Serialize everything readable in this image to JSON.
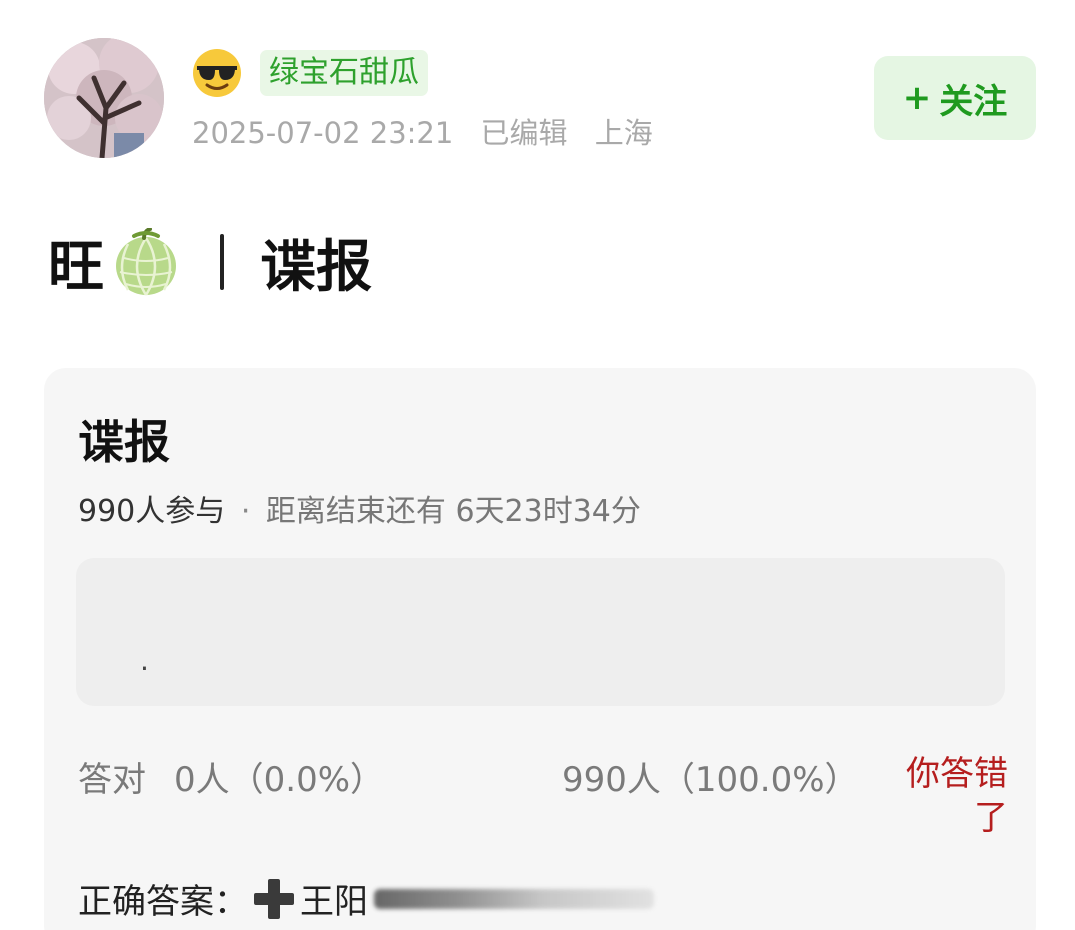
{
  "author": {
    "badge": "绿宝石甜瓜",
    "datetime": "2025-07-02 23:21",
    "edited": "已编辑",
    "location": "上海"
  },
  "follow_button": {
    "plus": "+",
    "label": "关注"
  },
  "post": {
    "title_prefix": "旺",
    "title_suffix": "谍报"
  },
  "quiz": {
    "title": "谍报",
    "participants": "990人参与",
    "separator": "·",
    "countdown": "距离结束还有 6天23时34分",
    "option_text": ".",
    "correct_label": "答对",
    "correct_count": "0人（0.0%）",
    "wrong_count": "990人（100.0%）",
    "wrong_message": "你答错了",
    "answer_label": "正确答案：",
    "answer_text": "王阳"
  },
  "colors": {
    "badge_text": "#2ea12d",
    "follow_bg": "#e5f6e3",
    "wrong_text": "#b51e1e",
    "card_bg": "#f6f6f6"
  },
  "icons": [
    "sunglasses-emoji-icon",
    "melon-emoji-icon",
    "plus-emoji-icon"
  ]
}
